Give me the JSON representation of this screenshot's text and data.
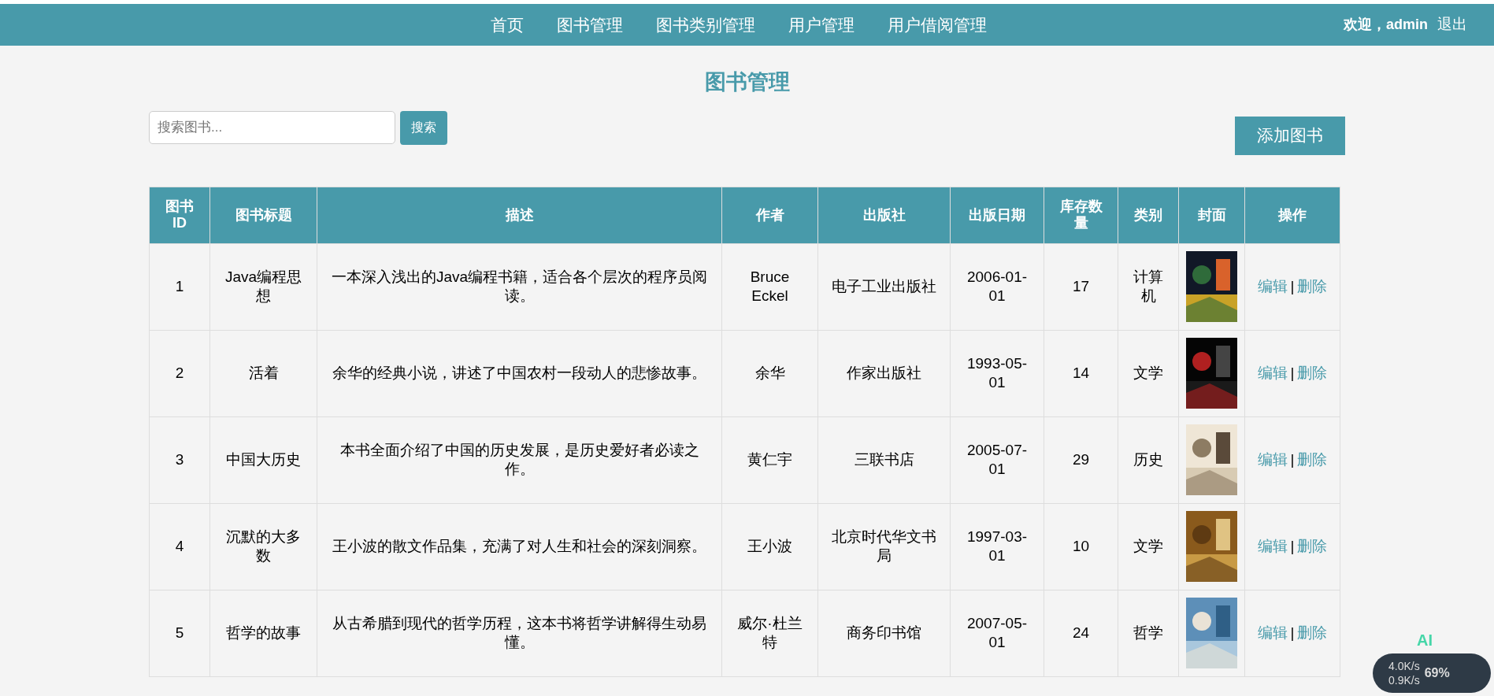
{
  "nav": {
    "links": [
      "首页",
      "图书管理",
      "图书类别管理",
      "用户管理",
      "用户借阅管理"
    ],
    "welcome": "欢迎，admin",
    "logout": "退出"
  },
  "title": "图书管理",
  "search": {
    "placeholder": "搜索图书...",
    "button": "搜索"
  },
  "add_button": "添加图书",
  "table": {
    "columns": [
      "图书ID",
      "图书标题",
      "描述",
      "作者",
      "出版社",
      "出版日期",
      "库存数量",
      "类别",
      "封面",
      "操作"
    ],
    "rows": [
      {
        "id": "1",
        "title": "Java编程思想",
        "description": "一本深入浅出的Java编程书籍，适合各个层次的程序员阅读。",
        "author": "Bruce Eckel",
        "publisher": "电子工业出版社",
        "date": "2006-01-01",
        "stock": "17",
        "category": "计算机",
        "actions": [
          "编辑",
          "删除"
        ],
        "separator": "|"
      },
      {
        "id": "2",
        "title": "活着",
        "description": "余华的经典小说，讲述了中国农村一段动人的悲惨故事。",
        "author": "余华",
        "publisher": "作家出版社",
        "date": "1993-05-01",
        "stock": "14",
        "category": "文学",
        "actions": [
          "编辑",
          "删除"
        ],
        "separator": "|"
      },
      {
        "id": "3",
        "title": "中国大历史",
        "description": "本书全面介绍了中国的历史发展，是历史爱好者必读之作。",
        "author": "黄仁宇",
        "publisher": "三联书店",
        "date": "2005-07-01",
        "stock": "29",
        "category": "历史",
        "actions": [
          "编辑",
          "删除"
        ],
        "separator": "|"
      },
      {
        "id": "4",
        "title": "沉默的大多数",
        "description": "王小波的散文作品集，充满了对人生和社会的深刻洞察。",
        "author": "王小波",
        "publisher": "北京时代华文书局",
        "date": "1997-03-01",
        "stock": "10",
        "category": "文学",
        "actions": [
          "编辑",
          "删除"
        ],
        "separator": "|"
      },
      {
        "id": "5",
        "title": "哲学的故事",
        "description": "从古希腊到现代的哲学历程，这本书将哲学讲解得生动易懂。",
        "author": "威尔·杜兰特",
        "publisher": "商务印书馆",
        "date": "2007-05-01",
        "stock": "24",
        "category": "哲学",
        "actions": [
          "编辑",
          "删除"
        ],
        "separator": "|"
      }
    ]
  },
  "overlay_widget": {
    "badge": "AI",
    "upload": "4.0K/s",
    "download": "0.9K/s",
    "percent": "69%"
  }
}
